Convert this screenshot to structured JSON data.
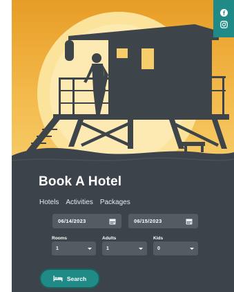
{
  "booking": {
    "title": "Book A Hotel",
    "tabs": [
      "Hotels",
      "Activities",
      "Packages"
    ],
    "checkin": "06/14/2023",
    "checkout": "06/15/2023",
    "fields": [
      {
        "label": "Rooms",
        "value": "1"
      },
      {
        "label": "Adults",
        "value": "1"
      },
      {
        "label": "Kids",
        "value": "0"
      }
    ],
    "search_label": "Search"
  },
  "social": {
    "icons": [
      "facebook-icon",
      "instagram-icon"
    ]
  },
  "colors": {
    "accent": "#1f8a86",
    "panel": "#3c434a",
    "field": "#545b62",
    "sky_top": "#e9a12c",
    "sky_bottom": "#f4c45e",
    "sun": "#fbe6a0",
    "silhouette": "#3d444a"
  }
}
